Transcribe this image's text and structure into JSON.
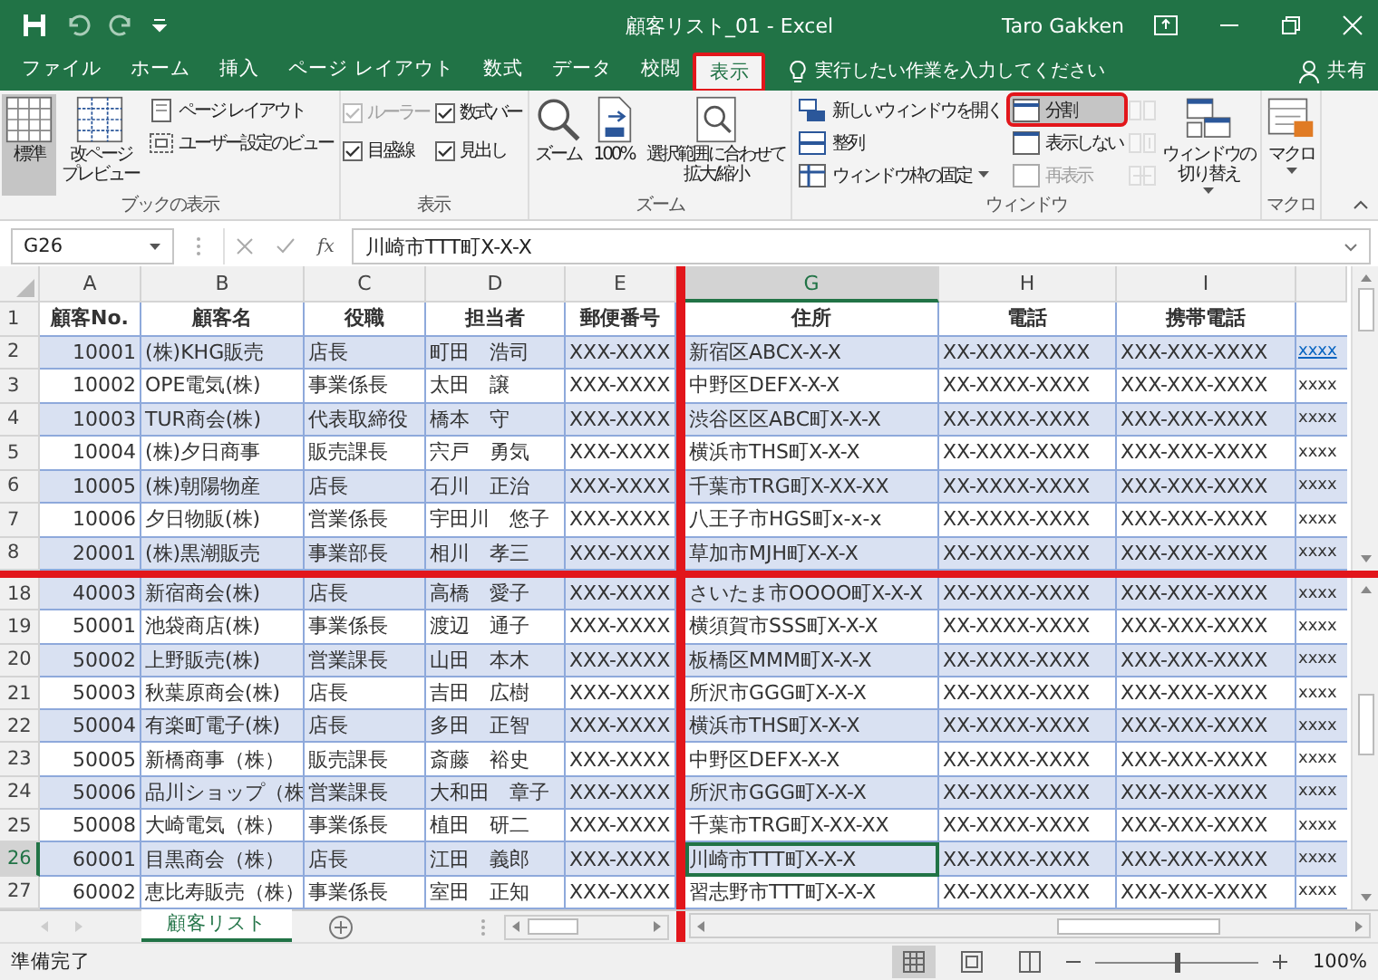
{
  "window": {
    "title": "顧客リスト_01 - Excel",
    "user": "Taro Gakken"
  },
  "tabs": [
    {
      "label": "ファイル",
      "selected": false,
      "annotated": false
    },
    {
      "label": "ホーム",
      "selected": false,
      "annotated": false
    },
    {
      "label": "挿入",
      "selected": false,
      "annotated": false
    },
    {
      "label": "ページ レイアウト",
      "selected": false,
      "annotated": false
    },
    {
      "label": "数式",
      "selected": false,
      "annotated": false
    },
    {
      "label": "データ",
      "selected": false,
      "annotated": false
    },
    {
      "label": "校閲",
      "selected": false,
      "annotated": false
    },
    {
      "label": "表示",
      "selected": true,
      "annotated": true
    }
  ],
  "tell_me": {
    "placeholder": "実行したい作業を入力してください"
  },
  "share": "共有",
  "ribbon": {
    "groups": [
      {
        "label": "ブックの表示",
        "columns": [
          {
            "kind": "large",
            "items": [
              {
                "lines": [
                  "標準"
                ],
                "selected": true
              }
            ]
          },
          {
            "kind": "large",
            "items": [
              {
                "lines": [
                  "改ページ",
                  "プレビュー"
                ],
                "selected": false
              }
            ]
          },
          {
            "kind": "stack",
            "items": [
              {
                "kind": "button",
                "label": "ページ レイアウト"
              },
              {
                "kind": "button",
                "label": "ユーザー設定のビュー"
              }
            ]
          }
        ]
      },
      {
        "label": "表示",
        "columns": [
          {
            "kind": "stack",
            "items": [
              {
                "kind": "check",
                "label": "ルーラー",
                "checked": true,
                "disabled": true
              },
              {
                "kind": "check",
                "label": "目盛線",
                "checked": true,
                "disabled": false
              }
            ]
          },
          {
            "kind": "stack",
            "items": [
              {
                "kind": "check",
                "label": "数式バー",
                "checked": true,
                "disabled": false
              },
              {
                "kind": "check",
                "label": "見出し",
                "checked": true,
                "disabled": false
              }
            ]
          }
        ]
      },
      {
        "label": "ズーム",
        "columns": [
          {
            "kind": "large",
            "items": [
              {
                "lines": [
                  "ズーム"
                ],
                "selected": false
              }
            ]
          },
          {
            "kind": "large",
            "items": [
              {
                "lines": [
                  "100%"
                ],
                "selected": false
              }
            ]
          },
          {
            "kind": "large",
            "items": [
              {
                "lines": [
                  "選択範囲に合わせて",
                  "拡大/縮小"
                ],
                "selected": false
              }
            ]
          }
        ]
      },
      {
        "label": "ウィンドウ",
        "columns": [
          {
            "kind": "stack",
            "items": [
              {
                "kind": "button",
                "label": "新しいウィンドウを開く"
              },
              {
                "kind": "button",
                "label": "整列"
              },
              {
                "kind": "button",
                "label": "ウィンドウ枠の固定",
                "dropdown": true
              }
            ]
          },
          {
            "kind": "stack",
            "items": [
              {
                "kind": "button",
                "label": "分割",
                "selected": true,
                "annotated": true
              },
              {
                "kind": "button",
                "label": "表示しない"
              },
              {
                "kind": "button",
                "label": "再表示",
                "disabled": true
              }
            ]
          },
          {
            "kind": "stack",
            "items": [
              {
                "kind": "icon",
                "disabled": true
              },
              {
                "kind": "icon",
                "disabled": true
              },
              {
                "kind": "icon",
                "disabled": true
              }
            ]
          },
          {
            "kind": "large",
            "items": [
              {
                "lines": [
                  "ウィンドウの",
                  "切り替え"
                ],
                "selected": false,
                "dropdown": true
              }
            ]
          }
        ]
      },
      {
        "label": "マクロ",
        "columns": [
          {
            "kind": "large",
            "items": [
              {
                "lines": [
                  "マクロ"
                ],
                "selected": false,
                "dropdown": true
              }
            ]
          }
        ]
      }
    ]
  },
  "formula_bar": {
    "name_box": "G26",
    "function_label": "fx",
    "formula": "川崎市TTT町X-X-X"
  },
  "sheet": {
    "split_highlight": true,
    "left_columns": [
      {
        "letter": "A",
        "selected": false
      },
      {
        "letter": "B",
        "selected": false
      },
      {
        "letter": "C",
        "selected": false
      },
      {
        "letter": "D",
        "selected": false
      },
      {
        "letter": "E",
        "selected": false
      }
    ],
    "right_columns": [
      {
        "letter": "G",
        "selected": true
      },
      {
        "letter": "H",
        "selected": false
      },
      {
        "letter": "I",
        "selected": false
      },
      {
        "selected": false
      }
    ],
    "top_rows": [
      {
        "number": "1",
        "kind": "header",
        "shaded": false,
        "selected": false,
        "cells": [
          "顧客No.",
          "顧客名",
          "役職",
          "担当者",
          "郵便番号",
          "住所",
          "電話",
          "携帯電話",
          ""
        ]
      },
      {
        "number": "2",
        "kind": "data",
        "shaded": true,
        "selected": false,
        "cells": [
          "10001",
          "(株)KHG販売",
          "店長",
          "町田　浩司",
          "XXX-XXXX",
          "新宿区ABCX-X-X",
          "XX-XXXX-XXXX",
          "XXX-XXX-XXXX",
          {
            "text": "xxxx",
            "kind": "link"
          }
        ]
      },
      {
        "number": "3",
        "kind": "data",
        "shaded": false,
        "selected": false,
        "cells": [
          "10002",
          "OPE電気(株)",
          "事業係長",
          "太田　譲",
          "XXX-XXXX",
          "中野区DEFX-X-X",
          "XX-XXXX-XXXX",
          "XXX-XXX-XXXX",
          "xxxx"
        ]
      },
      {
        "number": "4",
        "kind": "data",
        "shaded": true,
        "selected": false,
        "cells": [
          "10003",
          "TUR商会(株)",
          "代表取締役",
          "橋本　守",
          "XXX-XXXX",
          "渋谷区区ABC町X-X-X",
          "XX-XXXX-XXXX",
          "XXX-XXX-XXXX",
          "xxxx"
        ]
      },
      {
        "number": "5",
        "kind": "data",
        "shaded": false,
        "selected": false,
        "cells": [
          "10004",
          "(株)夕日商事",
          "販売課長",
          "宍戸　勇気",
          "XXX-XXXX",
          "横浜市THS町X-X-X",
          "XX-XXXX-XXXX",
          "XXX-XXX-XXXX",
          "xxxx"
        ]
      },
      {
        "number": "6",
        "kind": "data",
        "shaded": true,
        "selected": false,
        "cells": [
          "10005",
          "(株)朝陽物産",
          "店長",
          "石川　正治",
          "XXX-XXXX",
          "千葉市TRG町X-XX-XX",
          "XX-XXXX-XXXX",
          "XXX-XXX-XXXX",
          "xxxx"
        ]
      },
      {
        "number": "7",
        "kind": "data",
        "shaded": false,
        "selected": false,
        "cells": [
          "10006",
          "夕日物販(株)",
          "営業係長",
          "宇田川　悠子",
          "XXX-XXXX",
          "八王子市HGS町x-x-x",
          "XX-XXXX-XXXX",
          "XXX-XXX-XXXX",
          "xxxx"
        ]
      },
      {
        "number": "8",
        "kind": "data",
        "shaded": true,
        "selected": false,
        "cells": [
          "20001",
          "(株)黒潮販売",
          "事業部長",
          "相川　孝三",
          "XXX-XXXX",
          "草加市MJH町X-X-X",
          "XX-XXXX-XXXX",
          "XXX-XXX-XXXX",
          "xxxx"
        ]
      }
    ],
    "bottom_rows": [
      {
        "number": "18",
        "kind": "data",
        "shaded": true,
        "selected": false,
        "cells": [
          "40003",
          "新宿商会(株)",
          "店長",
          "高橋　愛子",
          "XXX-XXXX",
          "さいたま市OOOO町X-X-X",
          "XX-XXXX-XXXX",
          "XXX-XXX-XXXX",
          "xxxx"
        ]
      },
      {
        "number": "19",
        "kind": "data",
        "shaded": false,
        "selected": false,
        "cells": [
          "50001",
          "池袋商店(株)",
          "事業係長",
          "渡辺　通子",
          "XXX-XXXX",
          "横須賀市SSS町X-X-X",
          "XX-XXXX-XXXX",
          "XXX-XXX-XXXX",
          "xxxx"
        ]
      },
      {
        "number": "20",
        "kind": "data",
        "shaded": true,
        "selected": false,
        "cells": [
          "50002",
          "上野販売(株)",
          "営業課長",
          "山田　本木",
          "XXX-XXXX",
          "板橋区MMM町X-X-X",
          "XX-XXXX-XXXX",
          "XXX-XXX-XXXX",
          "xxxx"
        ]
      },
      {
        "number": "21",
        "kind": "data",
        "shaded": false,
        "selected": false,
        "cells": [
          "50003",
          "秋葉原商会(株)",
          "店長",
          "吉田　広樹",
          "XXX-XXXX",
          "所沢市GGG町X-X-X",
          "XX-XXXX-XXXX",
          "XXX-XXX-XXXX",
          "xxxx"
        ]
      },
      {
        "number": "22",
        "kind": "data",
        "shaded": true,
        "selected": false,
        "cells": [
          "50004",
          "有楽町電子(株)",
          "店長",
          "多田　正智",
          "XXX-XXXX",
          "横浜市THS町X-X-X",
          "XX-XXXX-XXXX",
          "XXX-XXX-XXXX",
          "xxxx"
        ]
      },
      {
        "number": "23",
        "kind": "data",
        "shaded": false,
        "selected": false,
        "cells": [
          "50005",
          "新橋商事（株）",
          "販売課長",
          "斎藤　裕史",
          "XXX-XXXX",
          "中野区DEFX-X-X",
          "XX-XXXX-XXXX",
          "XXX-XXX-XXXX",
          "xxxx"
        ]
      },
      {
        "number": "24",
        "kind": "data",
        "shaded": true,
        "selected": false,
        "cells": [
          "50006",
          "品川ショップ（株",
          "営業課長",
          "大和田　章子",
          "XXX-XXXX",
          "所沢市GGG町X-X-X",
          "XX-XXXX-XXXX",
          "XXX-XXX-XXXX",
          "xxxx"
        ]
      },
      {
        "number": "25",
        "kind": "data",
        "shaded": false,
        "selected": false,
        "cells": [
          "50008",
          "大崎電気（株）",
          "事業係長",
          "植田　研二",
          "XXX-XXXX",
          "千葉市TRG町X-XX-XX",
          "XX-XXXX-XXXX",
          "XXX-XXX-XXXX",
          "xxxx"
        ]
      },
      {
        "number": "26",
        "kind": "data",
        "shaded": true,
        "selected": true,
        "cells": [
          "60001",
          "目黒商会（株）",
          "店長",
          "江田　義郎",
          "XXX-XXXX",
          "川崎市TTT町X-X-X",
          "XX-XXXX-XXXX",
          "XXX-XXX-XXXX",
          "xxxx"
        ]
      },
      {
        "number": "27",
        "kind": "data",
        "shaded": false,
        "selected": false,
        "cells": [
          "60002",
          "恵比寿販売（株）",
          "事業係長",
          "室田　正知",
          "XXX-XXXX",
          "習志野市TTT町X-X-X",
          "XX-XXXX-XXXX",
          "XXX-XXX-XXXX",
          "xxxx"
        ]
      }
    ]
  },
  "sheet_tabs": [
    {
      "label": "顧客リスト",
      "selected": true
    }
  ],
  "status_bar": {
    "text": "準備完了",
    "views": [
      {
        "kind": "normal",
        "selected": true
      },
      {
        "kind": "page_layout",
        "selected": false
      },
      {
        "kind": "page_break",
        "selected": false
      }
    ],
    "zoom": {
      "level": 0.5,
      "label": "100%"
    }
  }
}
